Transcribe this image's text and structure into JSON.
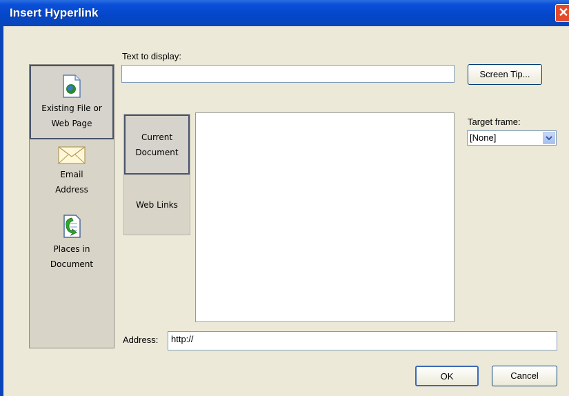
{
  "window": {
    "title": "Insert Hyperlink",
    "close_glyph": "✕"
  },
  "sidebar": {
    "items": [
      {
        "label_line1": "Existing File or",
        "label_line2": "Web Page",
        "icon": "globe-document-icon"
      },
      {
        "label_line1": "Email",
        "label_line2": "Address",
        "icon": "envelope-icon"
      },
      {
        "label_line1": "Places in",
        "label_line2": "Document",
        "icon": "document-arrow-icon"
      }
    ]
  },
  "form": {
    "text_to_display_label": "Text to display:",
    "text_to_display_value": "",
    "screen_tip_label": "Screen Tip...",
    "target_frame_label": "Target frame:",
    "target_frame_value": "[None]",
    "address_label": "Address:",
    "address_value": "http://"
  },
  "tabs": [
    {
      "label_line1": "Current",
      "label_line2": "Document"
    },
    {
      "label_line1": "Web Links",
      "label_line2": ""
    }
  ],
  "buttons": {
    "ok": "OK",
    "cancel": "Cancel"
  },
  "colors": {
    "titlebar": "#0a4fd8",
    "dialog_bg": "#ece9d8",
    "close_red": "#e24a2a"
  }
}
